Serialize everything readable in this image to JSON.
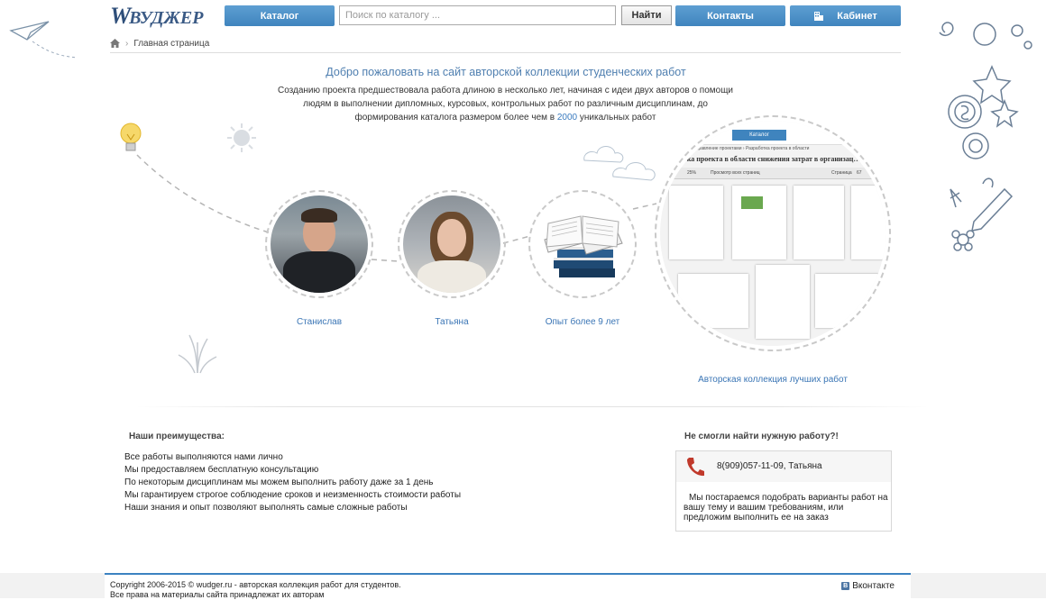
{
  "header": {
    "logo_text": "ВУДЖЕР",
    "logo_mark": "W",
    "nav": {
      "catalog": "Каталог",
      "contacts": "Контакты",
      "cabinet": "Кабинет"
    },
    "search": {
      "placeholder": "Поиск по каталогу ...",
      "value": "",
      "button": "Найти"
    }
  },
  "breadcrumb": {
    "current": "Главная страница",
    "separator": "›"
  },
  "hero": {
    "title": "Добро пожаловать на сайт авторской коллекции студенческих работ",
    "intro_part1": "Созданию проекта предшествовала работа длиною в несколько лет, начиная с идеи двух авторов о помощи людям в выполнении дипломных, курсовых, контрольных работ по различным дисциплинам, до формирования каталога размером более чем в ",
    "intro_highlight": "2000",
    "intro_part2": " уникальных работ"
  },
  "people": [
    {
      "caption": "Станислав"
    },
    {
      "caption": "Татьяна"
    },
    {
      "caption": "Опыт более 9 лет"
    }
  ],
  "collection": {
    "caption": "Авторская коллекция лучших работ",
    "preview": {
      "tab": "Каталог",
      "crumbs": "…управление › Управление проектами › Разработка проекта в области",
      "title": "…ботка проекта в области снижения затрат в организац…",
      "zoom": "25%",
      "view_label": "Просмотр всех страниц",
      "page_label": "Страница",
      "page_value": "67"
    }
  },
  "advantages": {
    "title": "Наши преимущества:",
    "items": [
      "Все работы выполняются нами лично",
      "Мы предоставляем бесплатную консультацию",
      "По некоторым дисциплинам мы можем выполнить работу даже за 1 день",
      "Мы гарантируем строгое соблюдение сроков и неизменность стоимости работы",
      "Наши знания и опыт позволяют выполнять самые сложные работы"
    ]
  },
  "contact": {
    "title": "Не смогли найти нужную работу?!",
    "phone": "8(909)057-11-09, Татьяна",
    "text": "Мы постараемся подобрать варианты работ на вашу тему и вашим требованиям, или предложим выполнить ее на заказ"
  },
  "footer": {
    "copyright": "Copyright 2006-2015 © wudger.ru - авторская коллекция работ для студентов.",
    "rights": "Все права на материалы сайта принадлежат их авторам",
    "vk": "Вконтакте",
    "vk_badge": "B"
  },
  "colors": {
    "accent": "#4a8cc7",
    "link": "#3a75b5",
    "footer_line": "#3c82c1"
  }
}
